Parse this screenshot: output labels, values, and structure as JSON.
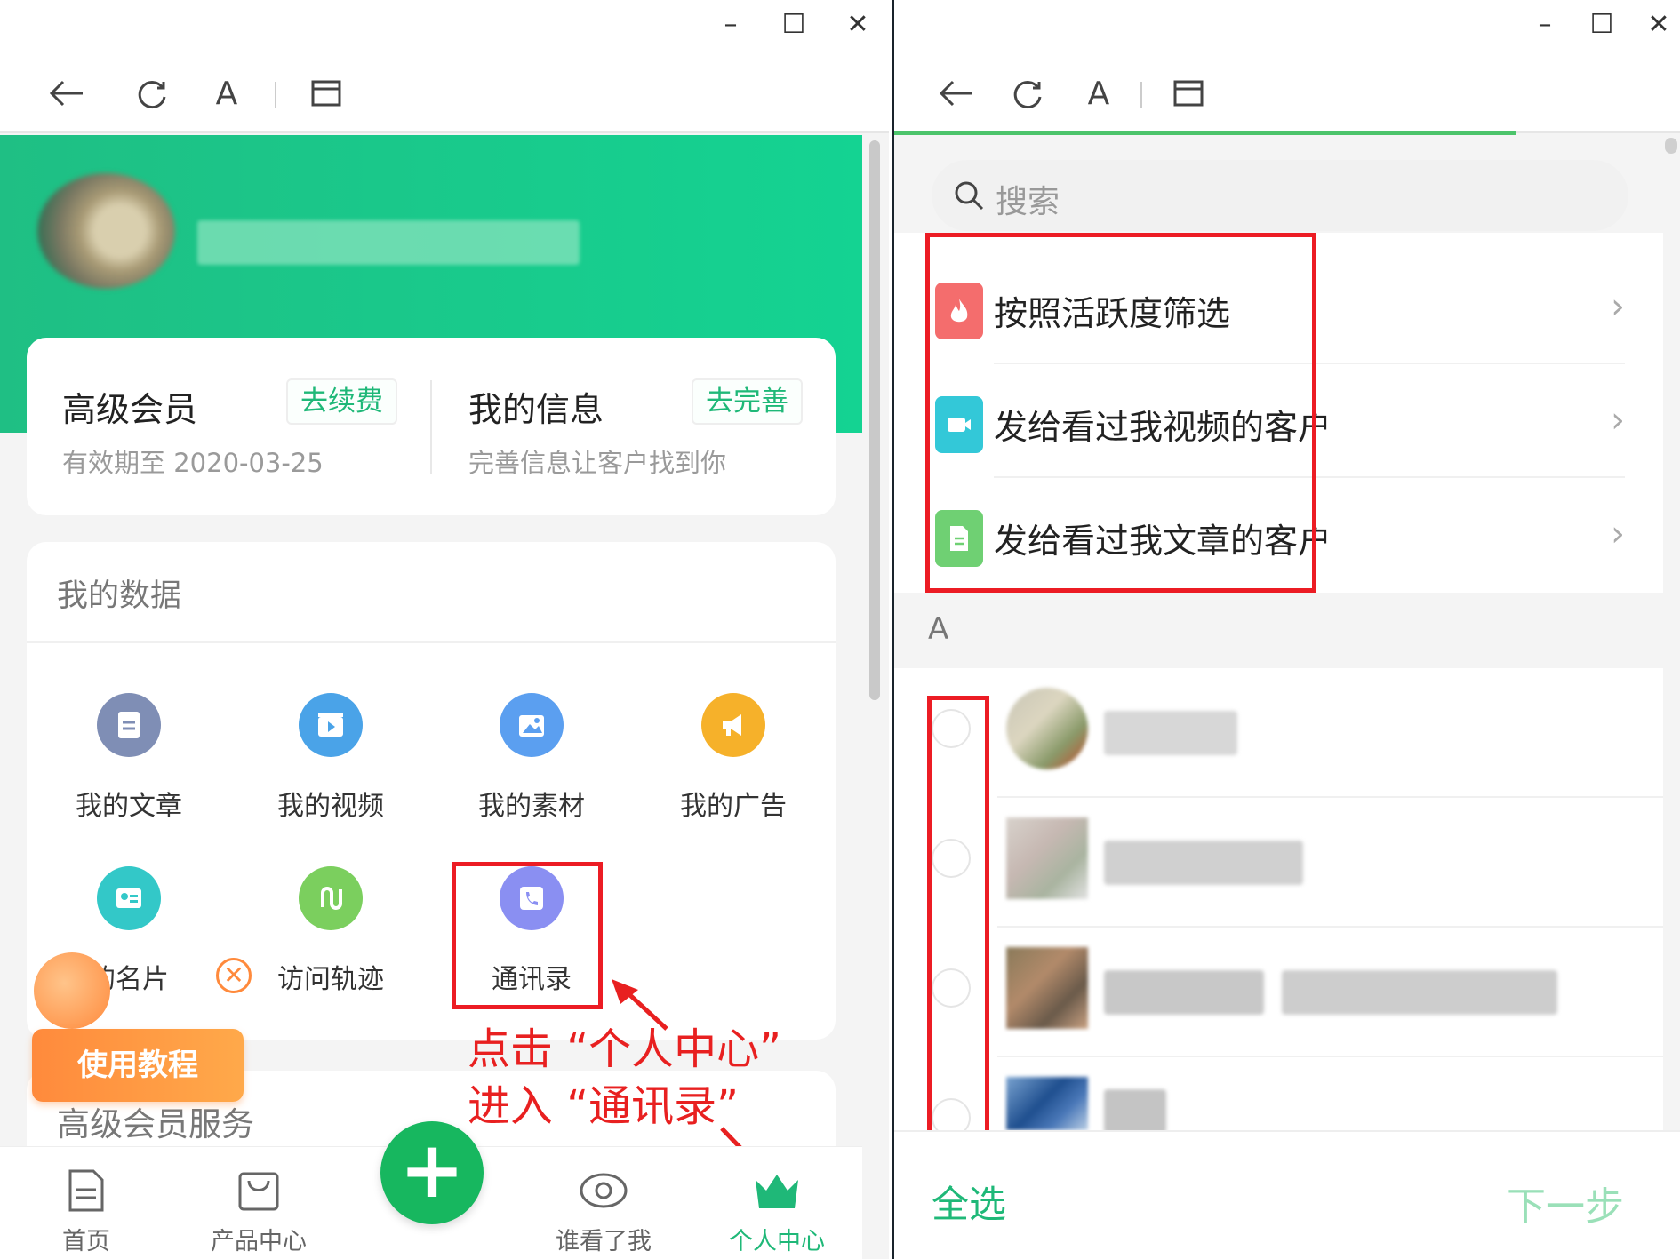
{
  "window": {
    "minimize": "–",
    "maximize": "☐",
    "close": "✕",
    "font_button": "A"
  },
  "left": {
    "member": {
      "title": "高级会员",
      "renew": "去续费",
      "expiry": "有效期至 2020-03-25",
      "info_title": "我的信息",
      "complete": "去完善",
      "info_sub": "完善信息让客户找到你"
    },
    "data_section": {
      "title": "我的数据",
      "items": [
        {
          "label": "我的文章",
          "icon": "article-icon",
          "color": "#7f8eb5"
        },
        {
          "label": "我的视频",
          "icon": "video-icon",
          "color": "#4aa3e8"
        },
        {
          "label": "我的素材",
          "icon": "material-icon",
          "color": "#5b9ff0"
        },
        {
          "label": "我的广告",
          "icon": "megaphone-icon",
          "color": "#f6b12a"
        },
        {
          "label": "的名片",
          "icon": "card-icon",
          "color": "#33c8c8"
        },
        {
          "label": "访问轨迹",
          "icon": "track-icon",
          "color": "#7bcf5e"
        },
        {
          "label": "通讯录",
          "icon": "contacts-icon",
          "color": "#8a8ff2"
        }
      ]
    },
    "tutorial": "使用教程",
    "service_title": "高级会员服务",
    "annotation_line1": "点击 “个人中心”",
    "annotation_line2": "进入 “通讯录”",
    "tabs": [
      {
        "label": "首页",
        "icon": "home-doc-icon"
      },
      {
        "label": "产品中心",
        "icon": "bag-icon"
      },
      {
        "label": "谁看了我",
        "icon": "eye-icon"
      },
      {
        "label": "个人中心",
        "icon": "crown-icon"
      }
    ],
    "fab": "+"
  },
  "right": {
    "search_placeholder": "搜索",
    "filters": [
      {
        "label": "按照活跃度筛选",
        "icon": "fire-icon",
        "color": "#f46d6d"
      },
      {
        "label": "发给看过我视频的客户",
        "icon": "camera-icon",
        "color": "#33c8d8"
      },
      {
        "label": "发给看过我文章的客户",
        "icon": "document-icon",
        "color": "#6fd073"
      }
    ],
    "section_letter": "A",
    "select_all": "全选",
    "next": "下一步"
  },
  "colors": {
    "brand_green": "#1fb878",
    "highlight_red": "#ec1c24"
  }
}
